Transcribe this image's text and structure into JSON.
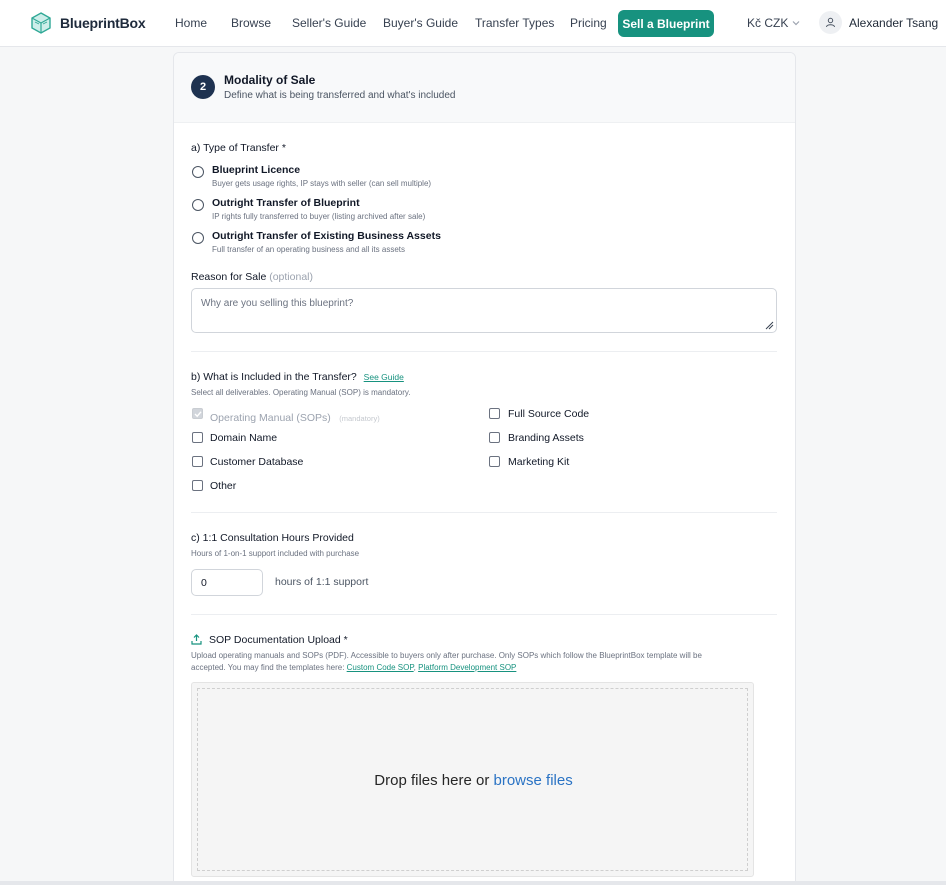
{
  "brand": {
    "name": "BlueprintBox",
    "accent": "#17927f"
  },
  "nav": {
    "items": [
      "Home",
      "Browse",
      "Seller's Guide",
      "Buyer's Guide",
      "Transfer Types",
      "Pricing"
    ],
    "cta": "Sell a Blueprint",
    "currency": "Kč CZK",
    "user": "Alexander Tsang"
  },
  "section": {
    "step": "2",
    "title": "Modality of Sale",
    "subtitle": "Define what is being transferred and what's included"
  },
  "transfer_type": {
    "title": "a) Type of Transfer *",
    "options": [
      {
        "label": "Blueprint Licence",
        "desc": "Buyer gets usage rights, IP stays with seller (can sell multiple)"
      },
      {
        "label": "Outright Transfer of Blueprint",
        "desc": "IP rights fully transferred to buyer (listing archived after sale)"
      },
      {
        "label": "Outright Transfer of Existing Business Assets",
        "desc": "Full transfer of an operating business and all its assets"
      }
    ]
  },
  "reason": {
    "label": "Reason for Sale",
    "optional": "(optional)",
    "placeholder": "Why are you selling this blueprint?"
  },
  "included": {
    "title": "b) What is Included in the Transfer?",
    "guide_link": "See Guide",
    "hint": "Select all deliverables. Operating Manual (SOP) is mandatory.",
    "mandatory_tag": "(mandatory)",
    "items": [
      {
        "label": "Operating Manual (SOPs)",
        "checked": true,
        "disabled": true
      },
      {
        "label": "Full Source Code",
        "checked": false
      },
      {
        "label": "Domain Name",
        "checked": false
      },
      {
        "label": "Branding Assets",
        "checked": false
      },
      {
        "label": "Customer Database",
        "checked": false
      },
      {
        "label": "Marketing Kit",
        "checked": false
      },
      {
        "label": "Other",
        "checked": false
      }
    ]
  },
  "consultation": {
    "title": "c) 1:1 Consultation Hours Provided",
    "hint": "Hours of 1-on-1 support included with purchase",
    "value": "0",
    "unit": "hours of 1:1 support"
  },
  "upload": {
    "title": "SOP Documentation Upload *",
    "desc_line1": "Upload operating manuals and SOPs (PDF). Accessible to buyers only after purchase. Only SOPs which follow the BlueprintBox template will be",
    "desc_line2": "accepted. You may find the templates here: ",
    "link1": "Custom Code SOP",
    "sep": ", ",
    "link2": "Platform Development SOP",
    "drop_text": "Drop files here or ",
    "browse_text": "browse files"
  }
}
